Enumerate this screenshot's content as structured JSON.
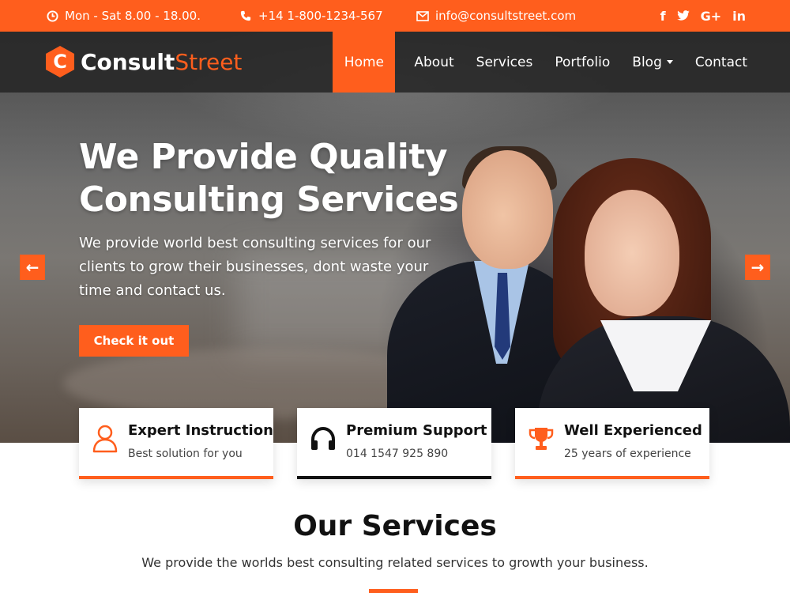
{
  "topbar": {
    "hours": "Mon - Sat 8.00 - 18.00.",
    "phone": "+14 1-800-1234-567",
    "email": "info@consultstreet.com",
    "social": [
      {
        "icon": "facebook-icon",
        "glyph": "f"
      },
      {
        "icon": "twitter-icon",
        "glyph": "🐦"
      },
      {
        "icon": "google-plus-icon",
        "glyph": "G+"
      },
      {
        "icon": "linkedin-icon",
        "glyph": "in"
      }
    ]
  },
  "header": {
    "logo_letter": "C",
    "logo_main": "Consult",
    "logo_accent": "Street",
    "nav": [
      {
        "label": "Home",
        "active": true
      },
      {
        "label": "About"
      },
      {
        "label": "Services"
      },
      {
        "label": "Portfolio"
      },
      {
        "label": "Blog",
        "dropdown": true
      },
      {
        "label": "Contact"
      }
    ]
  },
  "hero": {
    "title": "We Provide Quality Consulting Services",
    "description": "We provide world best consulting services for our clients to grow their businesses, dont waste your time and contact us.",
    "button_label": "Check it out",
    "prev_arrow": "←",
    "next_arrow": "→"
  },
  "features": [
    {
      "title": "Expert Instruction",
      "subtitle": "Best solution for you",
      "icon": "user-icon",
      "accent": "#ff5e1d"
    },
    {
      "title": "Premium Support",
      "subtitle": "014 1547 925 890",
      "icon": "headphones-icon",
      "accent": "#111111"
    },
    {
      "title": "Well Experienced",
      "subtitle": "25 years of experience",
      "icon": "trophy-icon",
      "accent": "#ff5e1d"
    }
  ],
  "services": {
    "title": "Our Services",
    "subtitle": "We provide the worlds best consulting related services to growth your business."
  },
  "colors": {
    "brand": "#ff5e1d",
    "header_bg": "#2f2f2f"
  }
}
